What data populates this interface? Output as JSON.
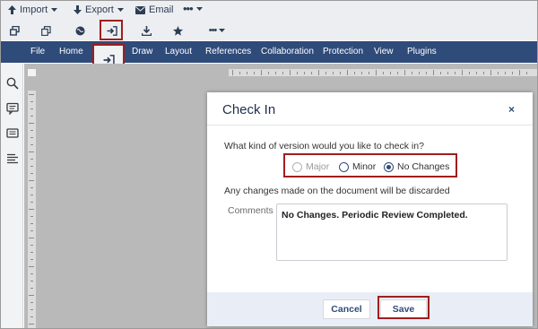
{
  "toolbar": {
    "menu": [
      {
        "label": "Import",
        "icon": "arrow-up-icon"
      },
      {
        "label": "Export",
        "icon": "arrow-down-icon"
      },
      {
        "label": "Email",
        "icon": "envelope-icon"
      }
    ],
    "icons": [
      "restore-window-icon",
      "copy-icon",
      "globe-icon",
      "check-in-icon",
      "download-icon",
      "star-icon",
      "more-icon"
    ]
  },
  "ribbon": {
    "tabs": [
      "File",
      "Home",
      "Draw",
      "Layout",
      "References",
      "Collaboration",
      "Protection",
      "View",
      "Plugins"
    ]
  },
  "dialog": {
    "title": "Check In",
    "close": "×",
    "question": "What kind of version would you like to check in?",
    "options": [
      {
        "label": "Major",
        "state": "disabled"
      },
      {
        "label": "Minor",
        "state": "enabled"
      },
      {
        "label": "No Changes",
        "state": "selected"
      }
    ],
    "discard_note": "Any changes made on the document will be discarded",
    "comments_label": "Comments",
    "comments_value": "No Changes. Periodic Review Completed.",
    "cancel_label": "Cancel",
    "save_label": "Save"
  },
  "colors": {
    "ribbon": "#2f4b7a",
    "highlight": "#a01e1e",
    "toolbar_bg": "#eceef1",
    "editor_bg": "#b9b9b9",
    "dialog_footer": "#e9eef6"
  }
}
